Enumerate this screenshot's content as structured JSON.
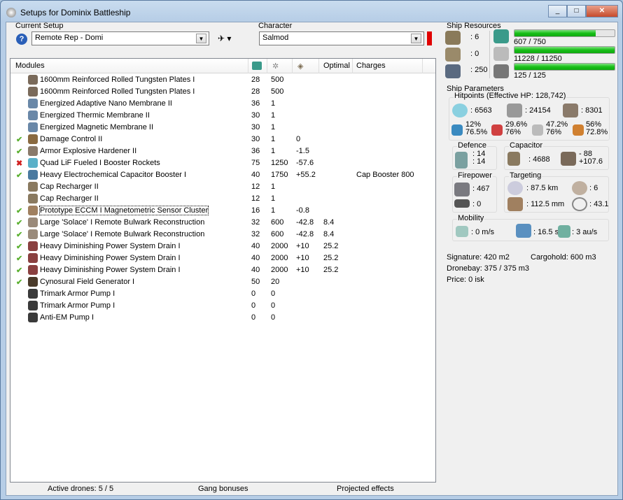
{
  "window": {
    "title": "Setups for Dominix Battleship"
  },
  "setup": {
    "label": "Current Setup",
    "value": "Remote Rep - Domi"
  },
  "character": {
    "label": "Character",
    "value": "Salmod",
    "status_color": "#e00000"
  },
  "columns": [
    "Modules",
    "",
    "",
    "",
    "Optimal",
    "Charges"
  ],
  "modules": [
    {
      "status": "",
      "name": "1600mm Reinforced Rolled Tungsten Plates I",
      "c1": "28",
      "c2": "500",
      "c3": "",
      "opt": "",
      "charge": "",
      "color": "#7a6a5a"
    },
    {
      "status": "",
      "name": "1600mm Reinforced Rolled Tungsten Plates I",
      "c1": "28",
      "c2": "500",
      "c3": "",
      "opt": "",
      "charge": "",
      "color": "#7a6a5a"
    },
    {
      "status": "",
      "name": "Energized Adaptive Nano Membrane II",
      "c1": "36",
      "c2": "1",
      "c3": "",
      "opt": "",
      "charge": "",
      "color": "#6a88a8"
    },
    {
      "status": "",
      "name": "Energized Thermic Membrane II",
      "c1": "30",
      "c2": "1",
      "c3": "",
      "opt": "",
      "charge": "",
      "color": "#6a88a8"
    },
    {
      "status": "",
      "name": "Energized Magnetic Membrane II",
      "c1": "30",
      "c2": "1",
      "c3": "",
      "opt": "",
      "charge": "",
      "color": "#6a88a8"
    },
    {
      "status": "ok",
      "name": "Damage Control II",
      "c1": "30",
      "c2": "1",
      "c3": "0",
      "opt": "",
      "charge": "",
      "color": "#8a6a40"
    },
    {
      "status": "ok",
      "name": "Armor Explosive Hardener II",
      "c1": "36",
      "c2": "1",
      "c3": "-1.5",
      "opt": "",
      "charge": "",
      "color": "#8a7a6a"
    },
    {
      "status": "bad",
      "name": "Quad LiF Fueled I Booster Rockets",
      "c1": "75",
      "c2": "1250",
      "c3": "-57.6",
      "opt": "",
      "charge": "",
      "color": "#5ab0c8"
    },
    {
      "status": "ok",
      "name": "Heavy Electrochemical Capacitor Booster I",
      "c1": "40",
      "c2": "1750",
      "c3": "+55.2",
      "opt": "",
      "charge": "Cap Booster 800",
      "color": "#4a7aa0"
    },
    {
      "status": "",
      "name": "Cap Recharger II",
      "c1": "12",
      "c2": "1",
      "c3": "",
      "opt": "",
      "charge": "",
      "color": "#8a7a60"
    },
    {
      "status": "",
      "name": "Cap Recharger II",
      "c1": "12",
      "c2": "1",
      "c3": "",
      "opt": "",
      "charge": "",
      "color": "#8a7a60"
    },
    {
      "status": "ok",
      "name": "Prototype ECCM I Magnetometric Sensor Cluster",
      "c1": "16",
      "c2": "1",
      "c3": "-0.8",
      "opt": "",
      "charge": "",
      "color": "#a08060",
      "focus": true
    },
    {
      "status": "ok",
      "name": "Large 'Solace' I Remote Bulwark Reconstruction",
      "c1": "32",
      "c2": "600",
      "c3": "-42.8",
      "opt": "8.4",
      "charge": "",
      "color": "#9a8a7a"
    },
    {
      "status": "ok",
      "name": "Large 'Solace' I Remote Bulwark Reconstruction",
      "c1": "32",
      "c2": "600",
      "c3": "-42.8",
      "opt": "8.4",
      "charge": "",
      "color": "#9a8a7a"
    },
    {
      "status": "ok",
      "name": "Heavy Diminishing Power System Drain I",
      "c1": "40",
      "c2": "2000",
      "c3": "+10",
      "opt": "25.2",
      "charge": "",
      "color": "#8a4040"
    },
    {
      "status": "ok",
      "name": "Heavy Diminishing Power System Drain I",
      "c1": "40",
      "c2": "2000",
      "c3": "+10",
      "opt": "25.2",
      "charge": "",
      "color": "#8a4040"
    },
    {
      "status": "ok",
      "name": "Heavy Diminishing Power System Drain I",
      "c1": "40",
      "c2": "2000",
      "c3": "+10",
      "opt": "25.2",
      "charge": "",
      "color": "#8a4040"
    },
    {
      "status": "ok",
      "name": "Cynosural Field Generator I",
      "c1": "50",
      "c2": "20",
      "c3": "",
      "opt": "",
      "charge": "",
      "color": "#4a3a2a"
    },
    {
      "status": "",
      "name": "Trimark Armor Pump I",
      "c1": "0",
      "c2": "0",
      "c3": "",
      "opt": "",
      "charge": "",
      "color": "#3a3a3a"
    },
    {
      "status": "",
      "name": "Trimark Armor Pump I",
      "c1": "0",
      "c2": "0",
      "c3": "",
      "opt": "",
      "charge": "",
      "color": "#3a3a3a"
    },
    {
      "status": "",
      "name": "Anti-EM Pump I",
      "c1": "0",
      "c2": "0",
      "c3": "",
      "opt": "",
      "charge": "",
      "color": "#3a3a3a"
    }
  ],
  "status": {
    "drones": "Active drones: 5 / 5",
    "gang": "Gang bonuses",
    "projected": "Projected effects"
  },
  "resources": {
    "title": "Ship Resources",
    "turrets": ": 6",
    "launchers": ": 0",
    "drone_bw": ": 250",
    "cpu": "607 / 750",
    "cpu_frac": 0.809,
    "pg": "11228 / 11250",
    "pg_frac": 0.998,
    "calib": "125 / 125",
    "calib_frac": 1.0
  },
  "params": {
    "title": "Ship Parameters",
    "hp_title": "Hitpoints (Effective HP: 128,742)",
    "shield": ": 6563",
    "armor": ": 24154",
    "structure": ": 8301",
    "res": [
      [
        "12%",
        "76.5%"
      ],
      [
        "29.6%",
        "76%"
      ],
      [
        "47.2%",
        "76%"
      ],
      [
        "56%",
        "72.8%"
      ]
    ],
    "defence_title": "Defence",
    "def1": ": 14",
    "def2": ": 14",
    "cap_title": "Capacitor",
    "cap": ": 4688",
    "cap_use": "- 88",
    "cap_gain": "+107.6",
    "fire_title": "Firepower",
    "dps": ": 467",
    "volley": ": 0",
    "targ_title": "Targeting",
    "range": ": 87.5 km",
    "targets": ": 6",
    "scan": ": 112.5 mm",
    "sensor": ": 43.1",
    "mob_title": "Mobility",
    "speed": ": 0 m/s",
    "align": ": 16.5 s",
    "warp": ": 3 au/s",
    "signature": "Signature: 420 m2",
    "cargo": "Cargohold: 600 m3",
    "dronebay": "Dronebay: 375 / 375 m3",
    "price": "Price: 0 isk"
  }
}
